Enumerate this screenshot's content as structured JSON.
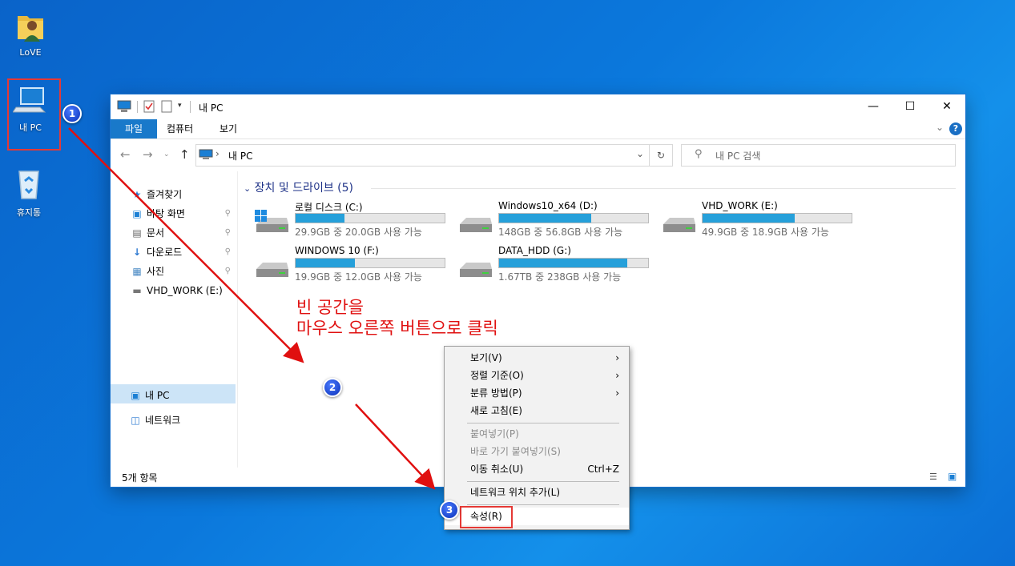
{
  "desktop": {
    "icons": [
      {
        "label": "LoVE"
      },
      {
        "label": "내 PC"
      },
      {
        "label": "휴지통"
      }
    ]
  },
  "badges": [
    "1",
    "2",
    "3"
  ],
  "window": {
    "title": "내 PC",
    "ribbon_tabs": [
      "파일",
      "컴퓨터",
      "보기"
    ],
    "address": "내 PC",
    "search_placeholder": "내 PC 검색",
    "nav": [
      {
        "label": "즐겨찾기"
      },
      {
        "label": "바탕 화면"
      },
      {
        "label": "문서"
      },
      {
        "label": "다운로드"
      },
      {
        "label": "사진"
      },
      {
        "label": "VHD_WORK (E:)"
      },
      {
        "label": "내 PC"
      },
      {
        "label": "네트워크"
      }
    ],
    "group_title": "장치 및 드라이브 (5)",
    "drives": [
      {
        "name": "로컬 디스크 (C:)",
        "size": "29.9GB 중 20.0GB 사용 가능",
        "used": 0.33,
        "windows": true
      },
      {
        "name": "Windows10_x64 (D:)",
        "size": "148GB 중 56.8GB 사용 가능",
        "used": 0.62,
        "windows": false
      },
      {
        "name": "VHD_WORK (E:)",
        "size": "49.9GB 중 18.9GB 사용 가능",
        "used": 0.62,
        "windows": false
      },
      {
        "name": "WINDOWS 10 (F:)",
        "size": "19.9GB 중 12.0GB 사용 가능",
        "used": 0.4,
        "windows": false
      },
      {
        "name": "DATA_HDD (G:)",
        "size": "1.67TB 중 238GB 사용 가능",
        "used": 0.86,
        "windows": false
      }
    ],
    "status": "5개 항목"
  },
  "annotation": {
    "line1": "빈 공간을",
    "line2": "마우스 오른쪽 버튼으로 클릭"
  },
  "context_menu": {
    "items": [
      {
        "label": "보기(V)",
        "submenu": true
      },
      {
        "label": "정렬 기준(O)",
        "submenu": true
      },
      {
        "label": "분류 방법(P)",
        "submenu": true
      },
      {
        "label": "새로 고침(E)"
      },
      {
        "label": "붙여넣기(P)",
        "disabled": true
      },
      {
        "label": "바로 가기 붙여넣기(S)",
        "disabled": true
      },
      {
        "label": "이동 취소(U)",
        "shortcut": "Ctrl+Z"
      },
      {
        "label": "네트워크 위치 추가(L)"
      },
      {
        "label": "속성(R)"
      }
    ]
  },
  "colors": {
    "accent": "#1979ca",
    "bar_fill": "#26a0da",
    "annotation": "#e01010",
    "highlight_box": "#e53935"
  }
}
